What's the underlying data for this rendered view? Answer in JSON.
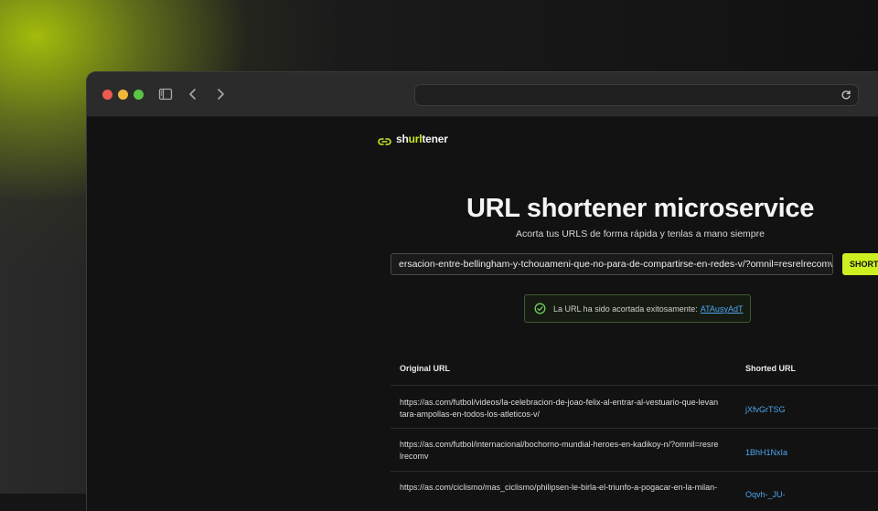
{
  "app": {
    "logo_prefix": "sh",
    "logo_accent": "url",
    "logo_suffix": "tener"
  },
  "hero": {
    "title": "URL shortener microservice",
    "subtitle": "Acorta tus URLS de forma rápida y tenlas a mano siempre"
  },
  "form": {
    "input_value": "ersacion-entre-bellingham-y-tchouameni-que-no-para-de-compartirse-en-redes-v/?omnil=resrelrecomv",
    "short_label": "SHORT"
  },
  "toast": {
    "message": "La URL ha sido acortada exitosamente:",
    "link": "ATAusyAdT"
  },
  "table": {
    "headers": [
      "Original URL",
      "Shorted URL"
    ],
    "rows": [
      {
        "original": "https://as.com/futbol/videos/la-celebracion-de-joao-felix-al-entrar-al-vestuario-que-levantara-ampollas-en-todos-los-atleticos-v/",
        "short": "jXfvGrTSG"
      },
      {
        "original": "https://as.com/futbol/internacional/bochorno-mundial-heroes-en-kadikoy-n/?omnil=resrelrecomv",
        "short": "1BhH1NxIa"
      },
      {
        "original": "https://as.com/ciclismo/mas_ciclismo/philipsen-le-birla-el-triunfo-a-pogacar-en-la-milan-",
        "short": "Oqvh-_JU-"
      }
    ]
  },
  "colors": {
    "accent": "#cdf021",
    "link": "#4ea6ee",
    "success": "#6ed05a"
  }
}
